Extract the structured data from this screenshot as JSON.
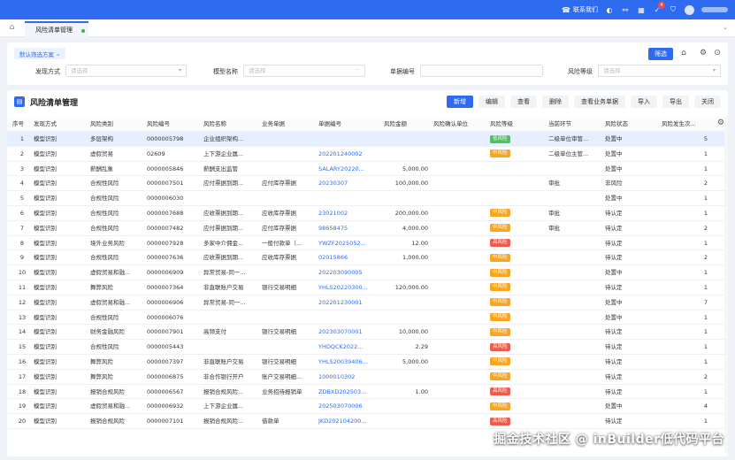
{
  "topbar": {
    "contact": "联系我们",
    "notify_count": "4",
    "accent": "#2f6bef"
  },
  "tabs": [
    {
      "label": "风险清单管理"
    }
  ],
  "filter": {
    "scheme": "默认筛选方案",
    "fields": [
      {
        "label": "发现方式",
        "placeholder": "请选择"
      },
      {
        "label": "模型名称",
        "placeholder": "请选择"
      },
      {
        "label": "单据编号",
        "placeholder": ""
      },
      {
        "label": "风险等级",
        "placeholder": "请选择"
      }
    ],
    "button": "筛选"
  },
  "main": {
    "title": "风险清单管理",
    "toolbar": [
      "新增",
      "编辑",
      "查看",
      "删除",
      "查看业务单据",
      "导入",
      "导出",
      "关闭"
    ],
    "columns": [
      "序号",
      "发现方式",
      "风险类别",
      "风险编号",
      "风险名称",
      "业务单据",
      "单据编号",
      "风险金额",
      "风险确认单位",
      "风险等级",
      "当前环节",
      "风险状态",
      "风险发生次..."
    ],
    "rows": [
      {
        "no": "1",
        "way": "模型识别",
        "cat": "多层架构",
        "code": "0000005798",
        "name": "企业组织架构...",
        "doc": "",
        "docno": "",
        "amt": "",
        "unit": "",
        "level": "低风险",
        "lv": "low",
        "step": "二级单位审管...",
        "status": "处置中",
        "times": "5"
      },
      {
        "no": "2",
        "way": "模型识别",
        "cat": "虚假贸易",
        "code": "02609",
        "name": "上下游企业属...",
        "doc": "",
        "docno": "202201240002",
        "amt": "",
        "unit": "",
        "level": "中风险",
        "lv": "mid",
        "step": "二级单位主管...",
        "status": "处置中",
        "times": "1"
      },
      {
        "no": "3",
        "way": "模型识别",
        "cat": "薪酬乱象",
        "code": "0000005846",
        "name": "薪酬支出监管",
        "doc": "",
        "docno": "SALARY20220...",
        "amt": "5,000.00",
        "unit": "",
        "level": "",
        "lv": "",
        "step": "",
        "status": "处置中",
        "times": "1"
      },
      {
        "no": "4",
        "way": "模型识别",
        "cat": "合规性风险",
        "code": "0000007501",
        "name": "应付票据到期...",
        "doc": "应付库存票据",
        "docno": "20230307",
        "amt": "100,000.00",
        "unit": "",
        "level": "",
        "lv": "",
        "step": "审批",
        "status": "非风险",
        "times": "2"
      },
      {
        "no": "5",
        "way": "模型识别",
        "cat": "合规性风险",
        "code": "0000006030",
        "name": "",
        "doc": "",
        "docno": "",
        "amt": "",
        "unit": "",
        "level": "",
        "lv": "",
        "step": "",
        "status": "处置中",
        "times": "1"
      },
      {
        "no": "6",
        "way": "模型识别",
        "cat": "合规性风险",
        "code": "0000007688",
        "name": "应收票据到期...",
        "doc": "应收库存票据",
        "docno": "23021002",
        "amt": "200,000.00",
        "unit": "",
        "level": "中风险",
        "lv": "mid",
        "step": "审批",
        "status": "待认定",
        "times": "1"
      },
      {
        "no": "7",
        "way": "模型识别",
        "cat": "合规性风险",
        "code": "0000007482",
        "name": "应付票据到期...",
        "doc": "应付库存票据",
        "docno": "98658475",
        "amt": "4,000.00",
        "unit": "",
        "level": "中风险",
        "lv": "mid",
        "step": "审批",
        "status": "待认定",
        "times": "2"
      },
      {
        "no": "8",
        "way": "模型识别",
        "cat": "境外业务风险",
        "code": "0000007928",
        "name": "多家中介佣金...",
        "doc": "一般付款单（...",
        "docno": "YWZF2025052...",
        "amt": "12.00",
        "unit": "",
        "level": "高风险",
        "lv": "high",
        "step": "",
        "status": "待认定",
        "times": "1"
      },
      {
        "no": "9",
        "way": "模型识别",
        "cat": "合规性风险",
        "code": "0000007636",
        "name": "应收票据到期...",
        "doc": "应收库存票据",
        "docno": "02015866",
        "amt": "1,000.00",
        "unit": "",
        "level": "中风险",
        "lv": "mid",
        "step": "",
        "status": "待认定",
        "times": "2"
      },
      {
        "no": "10",
        "way": "模型识别",
        "cat": "虚假贸易和融...",
        "code": "0000006909",
        "name": "异常贸易-同一...",
        "doc": "",
        "docno": "202203090005",
        "amt": "",
        "unit": "",
        "level": "中风险",
        "lv": "mid",
        "step": "",
        "status": "处置中",
        "times": "1"
      },
      {
        "no": "11",
        "way": "模型识别",
        "cat": "舞弊风险",
        "code": "0000007364",
        "name": "非直联账户交易",
        "doc": "银行交易明细",
        "docno": "YHLS20220300...",
        "amt": "120,000.00",
        "unit": "",
        "level": "中风险",
        "lv": "mid",
        "step": "",
        "status": "待认定",
        "times": "1"
      },
      {
        "no": "12",
        "way": "模型识别",
        "cat": "虚假贸易和融...",
        "code": "0000006906",
        "name": "异常贸易-同一...",
        "doc": "",
        "docno": "202201230001",
        "amt": "",
        "unit": "",
        "level": "中风险",
        "lv": "mid",
        "step": "",
        "status": "处置中",
        "times": "7"
      },
      {
        "no": "13",
        "way": "模型识别",
        "cat": "合规性风险",
        "code": "0000006076",
        "name": "",
        "doc": "",
        "docno": "",
        "amt": "",
        "unit": "",
        "level": "中风险",
        "lv": "mid",
        "step": "",
        "status": "处置中",
        "times": "1"
      },
      {
        "no": "14",
        "way": "模型识别",
        "cat": "财务金融风险",
        "code": "0000007901",
        "name": "高频支付",
        "doc": "银行交易明细",
        "docno": "202303070001",
        "amt": "10,000.00",
        "unit": "",
        "level": "中风险",
        "lv": "mid",
        "step": "",
        "status": "待认定",
        "times": "1"
      },
      {
        "no": "15",
        "way": "模型识别",
        "cat": "合规性风险",
        "code": "0000005443",
        "name": "",
        "doc": "",
        "docno": "YHDQCK2022...",
        "amt": "2.29",
        "unit": "",
        "level": "高风险",
        "lv": "high",
        "step": "",
        "status": "待认定",
        "times": "1"
      },
      {
        "no": "16",
        "way": "模型识别",
        "cat": "舞弊风险",
        "code": "0000007397",
        "name": "非直联账户交易",
        "doc": "银行交易明细",
        "docno": "YHLS20039406...",
        "amt": "5,000.00",
        "unit": "",
        "level": "中风险",
        "lv": "mid",
        "step": "",
        "status": "待认定",
        "times": "1"
      },
      {
        "no": "17",
        "way": "模型识别",
        "cat": "舞弊风险",
        "code": "0000006875",
        "name": "非合作银行开户",
        "doc": "账户交易明细...",
        "docno": "1000010302",
        "amt": "",
        "unit": "",
        "level": "中风险",
        "lv": "mid",
        "step": "",
        "status": "待认定",
        "times": "2"
      },
      {
        "no": "18",
        "way": "模型识别",
        "cat": "报销合规风险",
        "code": "0000006567",
        "name": "报销合规风险...",
        "doc": "业务招待报销单",
        "docno": "ZDBXD202503...",
        "amt": "1.00",
        "unit": "",
        "level": "高风险",
        "lv": "high",
        "step": "",
        "status": "待认定",
        "times": "1"
      },
      {
        "no": "19",
        "way": "模型识别",
        "cat": "虚假贸易和融...",
        "code": "0000006932",
        "name": "上下游企业属...",
        "doc": "",
        "docno": "202503070006",
        "amt": "",
        "unit": "",
        "level": "中风险",
        "lv": "mid",
        "step": "",
        "status": "处置中",
        "times": "4"
      },
      {
        "no": "20",
        "way": "模型识别",
        "cat": "报销合规风险",
        "code": "0000007101",
        "name": "报销合规风险...",
        "doc": "借款单",
        "docno": "JKD202104200...",
        "amt": "",
        "unit": "",
        "level": "高风险",
        "lv": "high",
        "step": "",
        "status": "待认定",
        "times": "1"
      }
    ]
  },
  "watermark": "掘金技术社区 @ inBuilder低代码平台"
}
